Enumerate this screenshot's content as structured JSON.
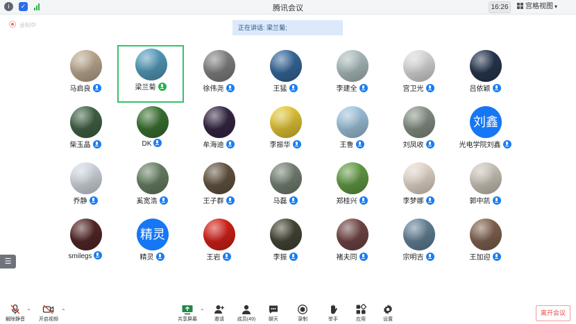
{
  "window": {
    "title": "腾讯会议",
    "time": "16:26",
    "view_label": "宫格视图"
  },
  "recording_label": "录制中",
  "speaking_banner": "正在讲话: 梁兰菊;",
  "participants": [
    {
      "name": "马启良",
      "mic": "muted",
      "avatar": "photo",
      "color": "#c9b59a"
    },
    {
      "name": "梁兰菊",
      "mic": "speaking",
      "avatar": "photo",
      "color": "#5aa6c8",
      "active": true
    },
    {
      "name": "徐伟尧",
      "mic": "muted",
      "avatar": "photo",
      "color": "#8a8a8a"
    },
    {
      "name": "王猛",
      "mic": "muted",
      "avatar": "photo",
      "color": "#3a6fa6"
    },
    {
      "name": "李建全",
      "mic": "muted",
      "avatar": "photo",
      "color": "#b7c9c9"
    },
    {
      "name": "宫卫光",
      "mic": "muted",
      "avatar": "photo",
      "color": "#e8e8e8"
    },
    {
      "name": "吕依颖",
      "mic": "muted",
      "avatar": "photo",
      "color": "#2a3a55"
    },
    {
      "name": "柴玉晶",
      "mic": "muted",
      "avatar": "photo",
      "color": "#466a4a"
    },
    {
      "name": "DK",
      "mic": "muted",
      "avatar": "photo",
      "color": "#3f7a35"
    },
    {
      "name": "牟海迪",
      "mic": "muted",
      "avatar": "photo",
      "color": "#3a2a4a"
    },
    {
      "name": "李振华",
      "mic": "muted",
      "avatar": "photo",
      "color": "#f1d23a"
    },
    {
      "name": "王鲁",
      "mic": "muted",
      "avatar": "photo",
      "color": "#a9d0ea"
    },
    {
      "name": "刘凤收",
      "mic": "muted",
      "avatar": "photo",
      "color": "#8f9a8f"
    },
    {
      "name": "光电学院刘鑫",
      "mic": "muted",
      "avatar": "text",
      "avatar_text": "刘鑫",
      "color": "#1677f5"
    },
    {
      "name": "乔静",
      "mic": "muted",
      "avatar": "photo",
      "color": "#dfe6ee"
    },
    {
      "name": "奚宽浩",
      "mic": "muted",
      "avatar": "photo",
      "color": "#6f8a6a"
    },
    {
      "name": "王子群",
      "mic": "muted",
      "avatar": "photo",
      "color": "#6a5a45"
    },
    {
      "name": "马磊",
      "mic": "muted",
      "avatar": "photo",
      "color": "#7b8a7a"
    },
    {
      "name": "郑桂兴",
      "mic": "muted",
      "avatar": "photo",
      "color": "#6aa64a"
    },
    {
      "name": "李梦娜",
      "mic": "muted",
      "avatar": "photo",
      "color": "#f3e6d8"
    },
    {
      "name": "郭中凯",
      "mic": "muted",
      "avatar": "photo",
      "color": "#d9d2c6"
    },
    {
      "name": "smilegs",
      "mic": "muted",
      "avatar": "photo",
      "color": "#5a2a2a"
    },
    {
      "name": "精灵",
      "mic": "muted",
      "avatar": "text",
      "avatar_text": "精灵",
      "color": "#1677f5"
    },
    {
      "name": "王岩",
      "mic": "muted",
      "avatar": "photo",
      "color": "#e2231a"
    },
    {
      "name": "李振",
      "mic": "muted",
      "avatar": "photo",
      "color": "#4a4a3a"
    },
    {
      "name": "褚夫同",
      "mic": "muted",
      "avatar": "photo",
      "color": "#7a4a4a"
    },
    {
      "name": "宗明吉",
      "mic": "muted",
      "avatar": "photo",
      "color": "#6a8aa0"
    },
    {
      "name": "王加迎",
      "mic": "muted",
      "avatar": "photo",
      "color": "#8a6a55"
    }
  ],
  "toolbar": {
    "unmute": "解除静音",
    "start_video": "开启视频",
    "share_screen": "共享屏幕",
    "invite": "邀请",
    "members": "成员(49)",
    "chat": "聊天",
    "record": "录制",
    "raise_hand": "举手",
    "apps": "应用",
    "settings": "设置",
    "leave": "离开会议"
  }
}
